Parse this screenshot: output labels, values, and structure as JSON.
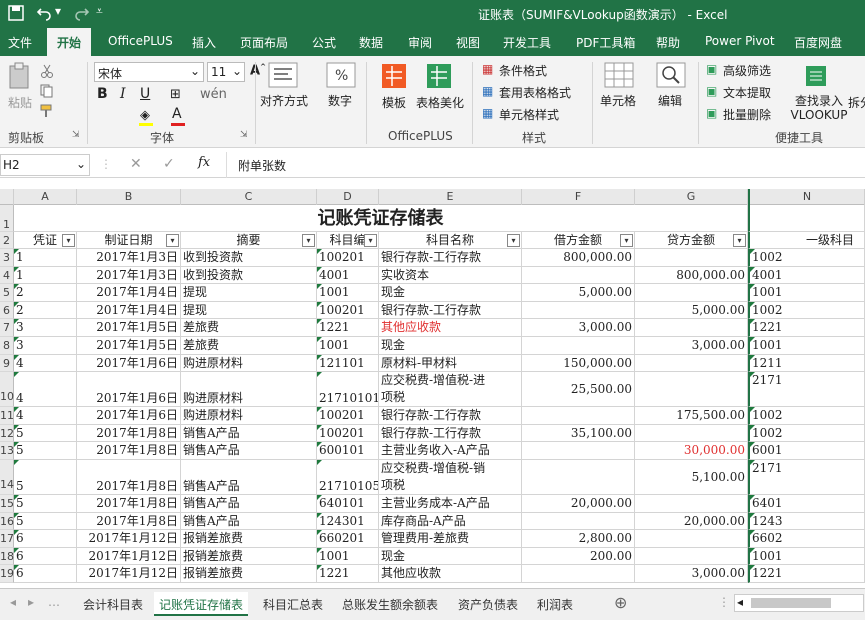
{
  "window": {
    "title": "证账表（SUMIF&VLookup函数演示） - Excel"
  },
  "tabs": [
    "文件",
    "开始",
    "OfficePLUS",
    "插入",
    "页面布局",
    "公式",
    "数据",
    "审阅",
    "视图",
    "开发工具",
    "PDF工具箱",
    "帮助",
    "Power Pivot",
    "百度网盘"
  ],
  "ribbon": {
    "paste": "粘贴",
    "clipboard": "剪贴板",
    "font_name": "宋体",
    "font_size": "11",
    "font_group": "字体",
    "align": "对齐方式",
    "number": "数字",
    "template": "模板",
    "table_beautify": "表格美化",
    "officeplus_group": "OfficePLUS",
    "cond_format": "条件格式",
    "table_format": "套用表格格式",
    "cell_style": "单元格样式",
    "style_group": "样式",
    "cells": "单元格",
    "edit": "编辑",
    "adv_filter": "高级筛选",
    "text_extract": "文本提取",
    "batch_delete": "批量删除",
    "find_vlookup": "查找录入VLOOKUP",
    "split": "拆分",
    "tools_group": "便捷工具"
  },
  "formula_bar": {
    "name_box": "H2",
    "content": "附单张数"
  },
  "columns": [
    "A",
    "B",
    "C",
    "D",
    "E",
    "F",
    "G",
    "N"
  ],
  "sheet_title": "记账凭证存储表",
  "headers": [
    "凭证号",
    "制证日期",
    "摘要",
    "科目编码",
    "科目名称",
    "借方金额",
    "贷方金额",
    "一级科目"
  ],
  "header_display": [
    "凭证",
    "制证日期",
    "摘要",
    "科目编",
    "科目名称",
    "借方金额",
    "贷方金额",
    "一级科目"
  ],
  "rows": [
    {
      "n": "3",
      "a": "1",
      "b": "2017年1月3日",
      "c": "收到投资款",
      "d": "100201",
      "e": "银行存款-工行存款",
      "f": "800,000.00",
      "g": "",
      "n2": "1002"
    },
    {
      "n": "4",
      "a": "1",
      "b": "2017年1月3日",
      "c": "收到投资款",
      "d": "4001",
      "e": "实收资本",
      "f": "",
      "g": "800,000.00",
      "n2": "4001"
    },
    {
      "n": "5",
      "a": "2",
      "b": "2017年1月4日",
      "c": "提现",
      "d": "1001",
      "e": "现金",
      "f": "5,000.00",
      "g": "",
      "n2": "1001"
    },
    {
      "n": "6",
      "a": "2",
      "b": "2017年1月4日",
      "c": "提现",
      "d": "100201",
      "e": "银行存款-工行存款",
      "f": "",
      "g": "5,000.00",
      "n2": "1002"
    },
    {
      "n": "7",
      "a": "3",
      "b": "2017年1月5日",
      "c": "差旅费",
      "d": "1221",
      "e": "其他应收款",
      "f": "3,000.00",
      "g": "",
      "n2": "1221",
      "ered": true
    },
    {
      "n": "8",
      "a": "3",
      "b": "2017年1月5日",
      "c": "差旅费",
      "d": "1001",
      "e": "现金",
      "f": "",
      "g": "3,000.00",
      "n2": "1001"
    },
    {
      "n": "9",
      "a": "4",
      "b": "2017年1月6日",
      "c": "购进原材料",
      "d": "121101",
      "e": "原材料-甲材料",
      "f": "150,000.00",
      "g": "",
      "n2": "1211"
    },
    {
      "n": "10",
      "a": "4",
      "b": "2017年1月6日",
      "c": "购进原材料",
      "d": "21710101",
      "e": "应交税费-增值税-进",
      "e2": "项税",
      "f": "25,500.00",
      "g": "",
      "n2": "2171",
      "tall": true
    },
    {
      "n": "11",
      "a": "4",
      "b": "2017年1月6日",
      "c": "购进原材料",
      "d": "100201",
      "e": "银行存款-工行存款",
      "f": "",
      "g": "175,500.00",
      "n2": "1002"
    },
    {
      "n": "12",
      "a": "5",
      "b": "2017年1月8日",
      "c": "销售A产品",
      "d": "100201",
      "e": "银行存款-工行存款",
      "f": "35,100.00",
      "g": "",
      "n2": "1002"
    },
    {
      "n": "13",
      "a": "5",
      "b": "2017年1月8日",
      "c": "销售A产品",
      "d": "600101",
      "e": "主营业务收入-A产品",
      "f": "",
      "g": "30,000.00",
      "n2": "6001",
      "gred": true
    },
    {
      "n": "14",
      "a": "5",
      "b": "2017年1月8日",
      "c": "销售A产品",
      "d": "21710105",
      "e": "应交税费-增值税-销",
      "e2": "项税",
      "f": "",
      "g": "5,100.00",
      "n2": "2171",
      "tall": true
    },
    {
      "n": "15",
      "a": "5",
      "b": "2017年1月8日",
      "c": "销售A产品",
      "d": "640101",
      "e": "主营业务成本-A产品",
      "f": "20,000.00",
      "g": "",
      "n2": "6401"
    },
    {
      "n": "16",
      "a": "5",
      "b": "2017年1月8日",
      "c": "销售A产品",
      "d": "124301",
      "e": "库存商品-A产品",
      "f": "",
      "g": "20,000.00",
      "n2": "1243"
    },
    {
      "n": "17",
      "a": "6",
      "b": "2017年1月12日",
      "c": "报销差旅费",
      "d": "660201",
      "e": "管理费用-差旅费",
      "f": "2,800.00",
      "g": "",
      "n2": "6602"
    },
    {
      "n": "18",
      "a": "6",
      "b": "2017年1月12日",
      "c": "报销差旅费",
      "d": "1001",
      "e": "现金",
      "f": "200.00",
      "g": "",
      "n2": "1001"
    },
    {
      "n": "19",
      "a": "6",
      "b": "2017年1月12日",
      "c": "报销差旅费",
      "d": "1221",
      "e": "其他应收款",
      "f": "",
      "g": "3,000.00",
      "n2": "1221"
    }
  ],
  "sheets": [
    "会计科目表",
    "记账凭证存储表",
    "科目汇总表",
    "总账发生额余额表",
    "资产负债表",
    "利润表"
  ]
}
